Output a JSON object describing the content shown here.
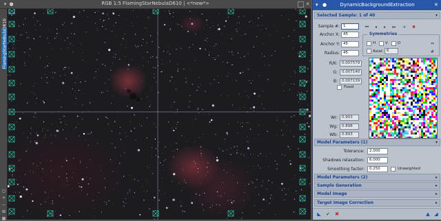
{
  "image_window": {
    "title": "RGB 1:5 FlamingStarNebulaD610 | <*new*>",
    "side_tab_label": "FlamingStarNebulaD610",
    "shade_icon": "square-icon",
    "close_icon": "close-icon"
  },
  "panel": {
    "title": "DynamicBackgroundExtraction",
    "sections": {
      "selected_sample": "Selected Sample: 1 of 40",
      "model_params_1": "Model Parameters (1)",
      "model_params_2": "Model Parameters (2)",
      "sample_generation": "Sample Generation",
      "model_image": "Model Image",
      "target_correction": "Target Image Correction"
    },
    "sample": {
      "sample_label": "Sample #:",
      "sample_value": "1",
      "anchor_x_label": "Anchor X:",
      "anchor_x": "45",
      "anchor_y_label": "Anchor Y:",
      "anchor_y": "45",
      "radius_label": "Radius:",
      "radius": "45",
      "rk_label": "R/K:",
      "rk": "0.007579",
      "g_label": "G:",
      "g": "0.007140",
      "b_label": "B:",
      "b": "0.007139",
      "fixed_label": "Fixed",
      "wr_label": "Wr:",
      "wr": "0.903",
      "wg_label": "Wg:",
      "wg": "0.898",
      "wb_label": "Wb:",
      "wb": "0.893"
    },
    "symmetries": {
      "title": "Symmetries",
      "h": "H",
      "v": "V",
      "d": "D",
      "axial": "Axial:",
      "axial_value": "6"
    },
    "model1": {
      "tolerance_label": "Tolerance:",
      "tolerance": "2.000",
      "shadows_label": "Shadows relaxation:",
      "shadows": "6.000",
      "smoothing_label": "Smoothing factor:",
      "smoothing": "0.250",
      "unweighted_label": "Unweighted"
    }
  },
  "colors": {
    "panel_title_bg": "#2856a8",
    "section_label": "#1c3f8c",
    "sample_box": "#35c8a8"
  }
}
